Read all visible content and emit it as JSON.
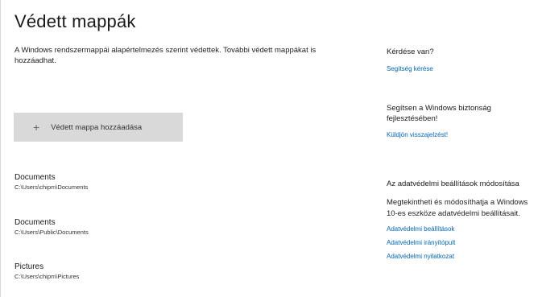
{
  "page": {
    "title": "Védett mappák",
    "description": "A Windows rendszermappái alapértelmezés szerint védettek. További védett mappákat is hozzáadhat."
  },
  "add_button": {
    "icon": "plus-icon",
    "label": "Védett mappa hozzáadása"
  },
  "folders": [
    {
      "name": "Documents",
      "path": "C:\\Users\\chipm\\Documents"
    },
    {
      "name": "Documents",
      "path": "C:\\Users\\Public\\Documents"
    },
    {
      "name": "Pictures",
      "path": "C:\\Users\\chipm\\Pictures"
    }
  ],
  "sidebar": {
    "question": {
      "heading": "Kérdése van?",
      "link": "Segítség kérése"
    },
    "feedback": {
      "heading": "Segítsen a Windows biztonság fejlesztésében!",
      "link": "Küldjön visszajelzést!"
    },
    "privacy": {
      "heading": "Az adatvédelmi beállítások módosítása",
      "body": "Megtekintheti és módosíthatja a Windows 10-es eszköze adatvédelmi beállításait.",
      "links": [
        "Adatvédelmi beállítások",
        "Adatvédelmi irányítópult",
        "Adatvédelmi nyilatkozat"
      ]
    }
  },
  "colors": {
    "accent_link": "#0067c0",
    "button_bg": "#d9d9d9"
  }
}
